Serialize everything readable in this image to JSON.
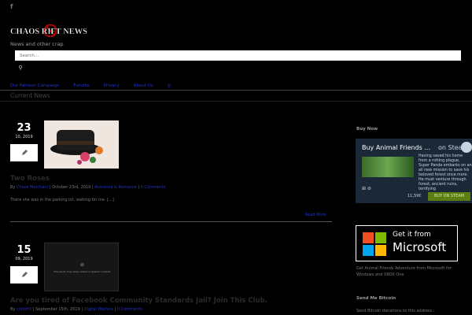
{
  "header": {
    "facebook_glyph": "f",
    "logo_text": "CHAOS RIFT NEWS",
    "tagline": "News and other crap",
    "search_placeholder": "Search...",
    "search_button_glyph": "⚲"
  },
  "nav": {
    "items": [
      {
        "label": "Our Patreon Campaign"
      },
      {
        "label": "Forums"
      },
      {
        "label": "Privacy"
      },
      {
        "label": "About Us"
      }
    ],
    "search_glyph": "⚲"
  },
  "section_title": "Current News",
  "posts": [
    {
      "day": "23",
      "month_year": "10, 2019",
      "title": "Two Roses",
      "meta_prefix": "By",
      "author": "Chaos Merchant",
      "date": "October 23rd, 2019",
      "categories": "Romance & Romance",
      "comments": "0 Comments",
      "excerpt": "There she was in the parking lot, waiting for me. [...]",
      "read_more": "Read More"
    },
    {
      "day": "15",
      "month_year": "09, 2019",
      "title": "Are you tired of Facebook Community Standards Jail? Join This Club.",
      "meta_prefix": "By",
      "author": "cnhbfr0",
      "date": "September 15th, 2019",
      "categories": "Digital Warfare",
      "comments": "0 Comments",
      "thumb_caption": "This photo may show violent or graphic content."
    }
  ],
  "sidebar": {
    "buy_now_title": "Buy Now",
    "steam": {
      "title": "Buy Animal Friends ...",
      "on_steam": "on Steam",
      "desc": "Having saved his home from a rotting plague, Super Panda embarks on an all new mission to save his beloved forest once more. He must venture through forest, ancient ruins, terrifying",
      "price": "11,59€",
      "buy_label": "BUY ON STEAM"
    },
    "microsoft": {
      "get_it": "Get it from",
      "brand": "Microsoft",
      "caption": "Get Animal Friends Adventure from Microsoft for Windows and XBOX One"
    },
    "bitcoin_title": "Send Me Bitcoin",
    "bitcoin_text": "Send Bitcoin donations to this address :"
  }
}
